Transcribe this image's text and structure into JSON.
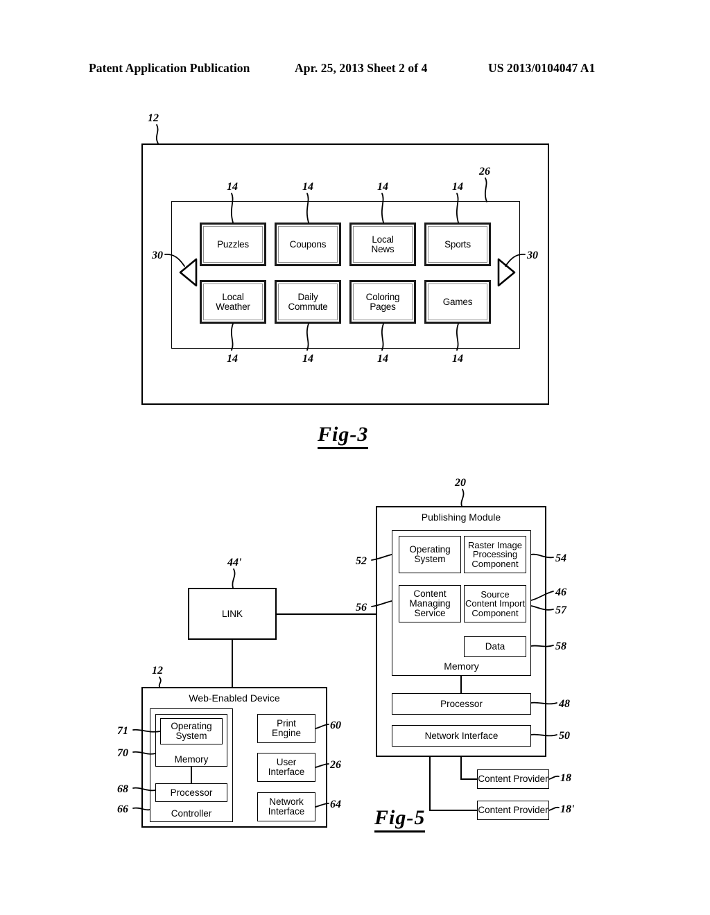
{
  "header": {
    "publication": "Patent Application Publication",
    "date_sheet": "Apr. 25, 2013  Sheet 2 of 4",
    "patent_number": "US 2013/0104047 A1"
  },
  "fig3": {
    "label": "Fig-3",
    "outer_ref": "12",
    "inner_ref": "26",
    "tile_ref": "14",
    "arrow_ref": "30",
    "left_arrow_icon": "left-triangle-icon",
    "right_arrow_icon": "right-triangle-icon",
    "tiles_row1": [
      "Puzzles",
      "Coupons",
      "Local\nNews",
      "Sports"
    ],
    "tiles_row2": [
      "Local\nWeather",
      "Daily\nCommute",
      "Coloring\nPages",
      "Games"
    ],
    "tile_refs_top": [
      "14",
      "14",
      "14",
      "14"
    ],
    "tile_refs_bottom": [
      "14",
      "14",
      "14",
      "14"
    ]
  },
  "fig5": {
    "label": "Fig-5",
    "publishing_module": {
      "title": "Publishing Module",
      "ref": "20",
      "memory_label": "Memory",
      "blocks": {
        "operating_system": "Operating\nSystem",
        "raster_image": "Raster Image\nProcessing\nComponent",
        "content_managing": "Content\nManaging\nService",
        "source_import": "Source\nContent Import\nComponent",
        "data": "Data",
        "processor": "Processor",
        "network_interface": "Network Interface"
      },
      "refs": {
        "operating_system": "52",
        "raster_image": "54",
        "content_managing": "56",
        "memory": "46",
        "source_import": "57",
        "data": "58",
        "processor": "48",
        "network_interface": "50"
      }
    },
    "link": {
      "label": "LINK",
      "ref": "44'"
    },
    "web_enabled_device": {
      "title": "Web-Enabled Device",
      "ref": "12",
      "controller_label": "Controller",
      "memory_label": "Memory",
      "blocks": {
        "operating_system": "Operating\nSystem",
        "processor": "Processor",
        "print_engine": "Print\nEngine",
        "user_interface": "User\nInterface",
        "network_interface": "Network\nInterface"
      },
      "refs": {
        "operating_system": "71",
        "memory": "70",
        "processor": "68",
        "controller": "66",
        "print_engine": "60",
        "user_interface": "26",
        "network_interface": "64"
      }
    },
    "content_providers": [
      {
        "label": "Content Provider",
        "ref": "18"
      },
      {
        "label": "Content Provider",
        "ref": "18'"
      }
    ]
  },
  "colors": {
    "ink": "#000000",
    "bevel": "#8d8d8d"
  }
}
